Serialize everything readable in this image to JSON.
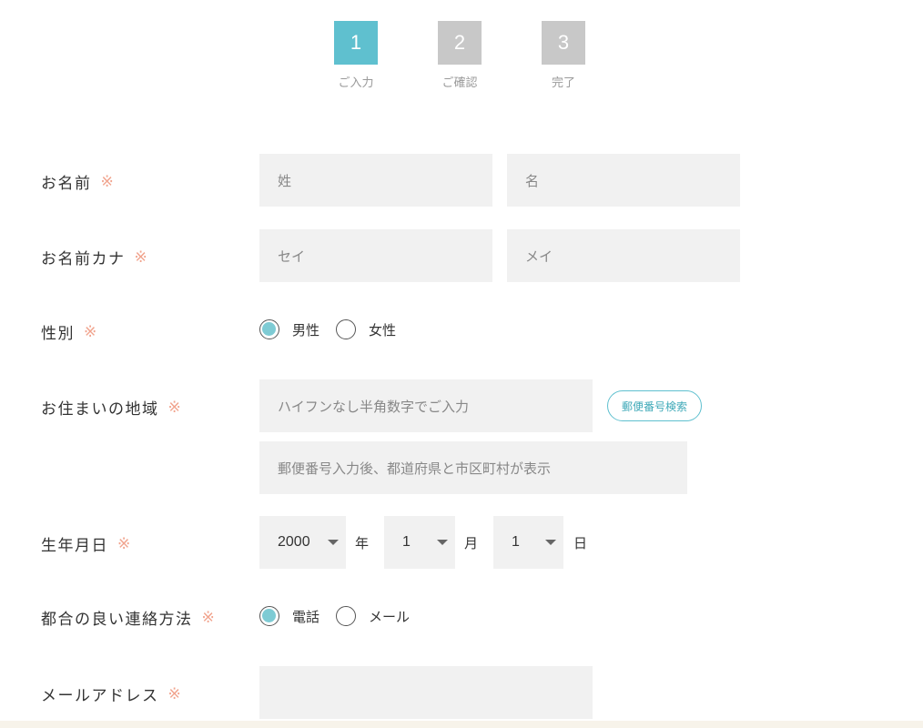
{
  "stepper": [
    {
      "num": "1",
      "label": "ご入力"
    },
    {
      "num": "2",
      "label": "ご確認"
    },
    {
      "num": "3",
      "label": "完了"
    }
  ],
  "required_mark": "※",
  "name": {
    "label": "お名前",
    "last_placeholder": "姓",
    "first_placeholder": "名"
  },
  "kana": {
    "label": "お名前カナ",
    "last_placeholder": "セイ",
    "first_placeholder": "メイ"
  },
  "gender": {
    "label": "性別",
    "options": [
      "男性",
      "女性"
    ],
    "selected": "男性"
  },
  "address": {
    "label": "お住まいの地域",
    "zip_placeholder": "ハイフンなし半角数字でご入力",
    "zip_button": "郵便番号検索",
    "area_placeholder": "郵便番号入力後、都道府県と市区町村が表示"
  },
  "birthdate": {
    "label": "生年月日",
    "year": "2000",
    "year_unit": "年",
    "month": "1",
    "month_unit": "月",
    "day": "1",
    "day_unit": "日"
  },
  "contact_method": {
    "label": "都合の良い連絡方法",
    "options": [
      "電話",
      "メール"
    ],
    "selected": "電話"
  },
  "email": {
    "label": "メールアドレス",
    "value": ""
  },
  "colors": {
    "accent": "#5fc0cf",
    "required": "#f1a48e",
    "input_bg": "#f1f1f1",
    "inactive_step": "#c8c8c8"
  }
}
